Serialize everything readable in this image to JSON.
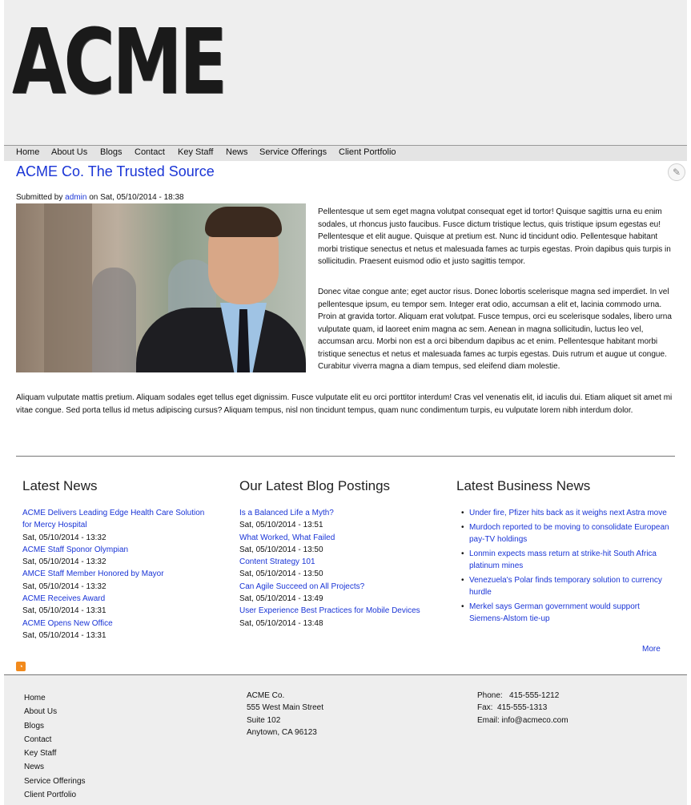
{
  "brand": {
    "logo_text": "ACME"
  },
  "nav": [
    "Home",
    "About Us",
    "Blogs",
    "Contact",
    "Key Staff",
    "News",
    "Service Offerings",
    "Client Portfolio"
  ],
  "article": {
    "title": "ACME Co. The Trusted Source",
    "submitted_prefix": "Submitted by",
    "author": "admin",
    "submitted_suffix": "on Sat, 05/10/2014 - 18:38",
    "paragraphs": [
      "Pellentesque ut sem eget magna volutpat consequat eget id tortor! Quisque sagittis urna eu enim sodales, ut rhoncus justo faucibus. Fusce dictum tristique lectus, quis tristique ipsum egestas eu! Pellentesque et elit augue. Quisque at pretium est. Nunc id tincidunt odio. Pellentesque habitant morbi tristique senectus et netus et malesuada fames ac turpis egestas. Proin dapibus quis turpis in sollicitudin. Praesent euismod odio et justo sagittis tempor.",
      "Donec vitae congue ante; eget auctor risus. Donec lobortis scelerisque magna sed imperdiet. In vel pellentesque ipsum, eu tempor sem. Integer erat odio, accumsan a elit et, lacinia commodo urna. Proin at gravida tortor. Aliquam erat volutpat. Fusce tempus, orci eu scelerisque sodales, libero urna vulputate quam, id laoreet enim magna ac sem. Aenean in magna sollicitudin, luctus leo vel, accumsan arcu. Morbi non est a orci bibendum dapibus ac et enim. Pellentesque habitant morbi tristique senectus et netus et malesuada fames ac turpis egestas. Duis rutrum et augue ut congue. Curabitur viverra magna a diam tempus, sed eleifend diam molestie.",
      "Aliquam vulputate mattis pretium. Aliquam sodales eget tellus eget dignissim. Fusce vulputate elit eu orci porttitor interdum! Cras vel venenatis elit, id iaculis dui. Etiam aliquet sit amet mi vitae congue. Sed porta tellus id metus adipiscing cursus? Aliquam tempus, nisl non tincidunt tempus, quam nunc condimentum turpis, eu vulputate lorem nibh interdum dolor."
    ]
  },
  "latest_news": {
    "title": "Latest News",
    "items": [
      {
        "lines": [
          "ACME Delivers Leading Edge Health Care Solution",
          "for Mercy Hospital"
        ],
        "date": "Sat, 05/10/2014 - 13:32"
      },
      {
        "lines": [
          "ACME Staff Sponor Olympian"
        ],
        "date": "Sat, 05/10/2014 - 13:32"
      },
      {
        "lines": [
          "AMCE Staff Member Honored by Mayor"
        ],
        "date": "Sat, 05/10/2014 - 13:32"
      },
      {
        "lines": [
          "ACME Receives Award"
        ],
        "date": "Sat, 05/10/2014 - 13:31"
      },
      {
        "lines": [
          "ACME Opens New Office"
        ],
        "date": "Sat, 05/10/2014 - 13:31"
      }
    ]
  },
  "blog": {
    "title": "Our Latest Blog Postings",
    "items": [
      {
        "lines": [
          "Is a Balanced Life a Myth?"
        ],
        "date": "Sat, 05/10/2014 - 13:51"
      },
      {
        "lines": [
          "What Worked, What Failed"
        ],
        "date": "Sat, 05/10/2014 - 13:50"
      },
      {
        "lines": [
          "Content Strategy 101"
        ],
        "date": "Sat, 05/10/2014 - 13:50"
      },
      {
        "lines": [
          "Can Agile Succeed on All Projects?"
        ],
        "date": "Sat, 05/10/2014 - 13:49"
      },
      {
        "lines": [
          "User Experience Best Practices for Mobile Devices"
        ],
        "date": "Sat, 05/10/2014 - 13:48"
      }
    ]
  },
  "business_news": {
    "title": "Latest Business News",
    "items": [
      "Under fire, Pfizer hits back as it weighs next Astra move",
      "Murdoch reported to be moving to consolidate European pay-TV holdings",
      "Lonmin expects mass return at strike-hit South Africa platinum mines",
      "Venezuela's Polar finds temporary solution to currency hurdle",
      "Merkel says German government would support Siemens-Alstom tie-up"
    ],
    "more": "More"
  },
  "footer": {
    "nav": [
      "Home",
      "About Us",
      "Blogs",
      "Contact",
      "Key Staff",
      "News",
      "Service Offerings",
      "Client Portfolio"
    ],
    "address": [
      "ACME Co.",
      "555 West Main Street",
      "Suite 102",
      "Anytown, CA 96123"
    ],
    "contact": [
      "Phone:   415-555-1212",
      "Fax:  415-555-1313",
      "Email: info@acmeco.com"
    ]
  },
  "colors": {
    "link": "#1a35d6",
    "header_bg": "#eeeeee",
    "rss": "#f28a1c"
  },
  "icons": {
    "edit": "pencil-icon",
    "feed": "rss-icon"
  }
}
